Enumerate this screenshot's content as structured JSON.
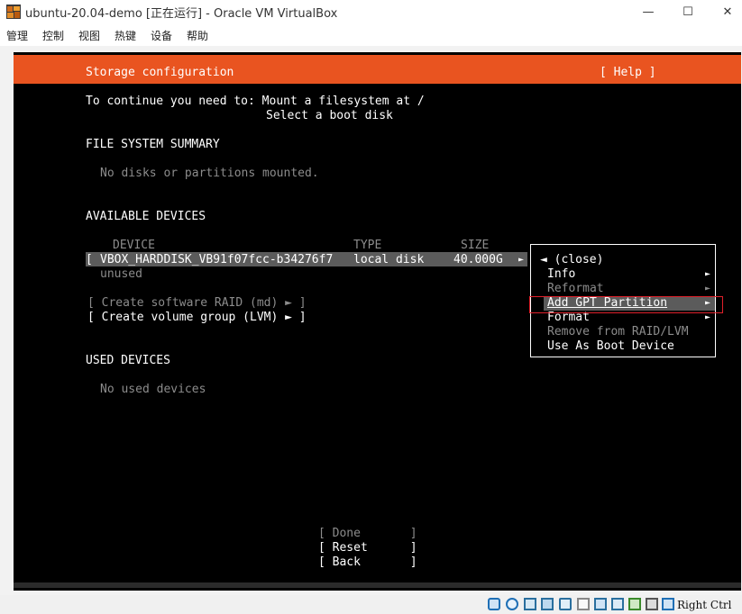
{
  "window": {
    "title": "ubuntu-20.04-demo [正在运行] - Oracle VM VirtualBox",
    "controls": {
      "minimize": "—",
      "maximize": "☐",
      "close": "✕"
    }
  },
  "menu": [
    "管理",
    "控制",
    "视图",
    "热键",
    "设备",
    "帮助"
  ],
  "screen": {
    "header": {
      "title": "Storage configuration",
      "help": "[ Help ]"
    },
    "intro": {
      "line1": "To continue you need to: Mount a filesystem at /",
      "line2": "Select a boot disk"
    },
    "fs_summary": {
      "heading": "FILE SYSTEM SUMMARY",
      "empty": "No disks or partitions mounted."
    },
    "available": {
      "heading": "AVAILABLE DEVICES",
      "columns": {
        "device": "DEVICE",
        "type": "TYPE",
        "size": "SIZE"
      },
      "device": {
        "open": "[",
        "name": "VBOX_HARDDISK_VB91f07fcc-b34276f7",
        "type": "local disk",
        "size": "40.000G",
        "arrow": "►",
        "status": "unused"
      },
      "raid": "[ Create software RAID (md) ► ]",
      "lvm": "[ Create volume group (LVM) ► ]"
    },
    "used": {
      "heading": "USED DEVICES",
      "empty": "No used devices"
    },
    "popup": {
      "close": "◄ (close)",
      "items": [
        "Info",
        "Reformat",
        "Add GPT Partition",
        "Format",
        "Remove from RAID/LVM",
        "Use As Boot Device"
      ],
      "arrow": "►"
    },
    "buttons": {
      "done": "[ Done       ]",
      "reset": "[ Reset      ]",
      "back": "[ Back       ]"
    }
  },
  "status": {
    "host_key": "Right Ctrl"
  }
}
